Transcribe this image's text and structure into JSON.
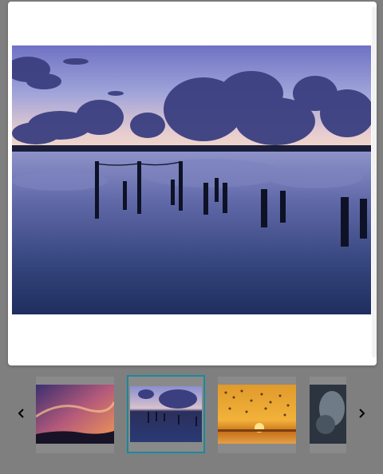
{
  "viewer": {
    "main_image": {
      "subject": "seascape-twilight-pier-posts",
      "colors": {
        "sky_top": "#5b6fb4",
        "sky_horizon": "#e9c9c4",
        "water": "#3c4d86"
      }
    }
  },
  "thumbnails": [
    {
      "subject": "sunset-clouds-pink",
      "active": false
    },
    {
      "subject": "twilight-pier-posts",
      "active": true
    },
    {
      "subject": "sunset-birds-orange",
      "active": false
    },
    {
      "subject": "storm-clouds-grey",
      "active": false
    }
  ],
  "navigation": {
    "prev_icon": "chevron-left-icon",
    "next_icon": "chevron-right-icon"
  },
  "accent_color": "#1a8a9c"
}
